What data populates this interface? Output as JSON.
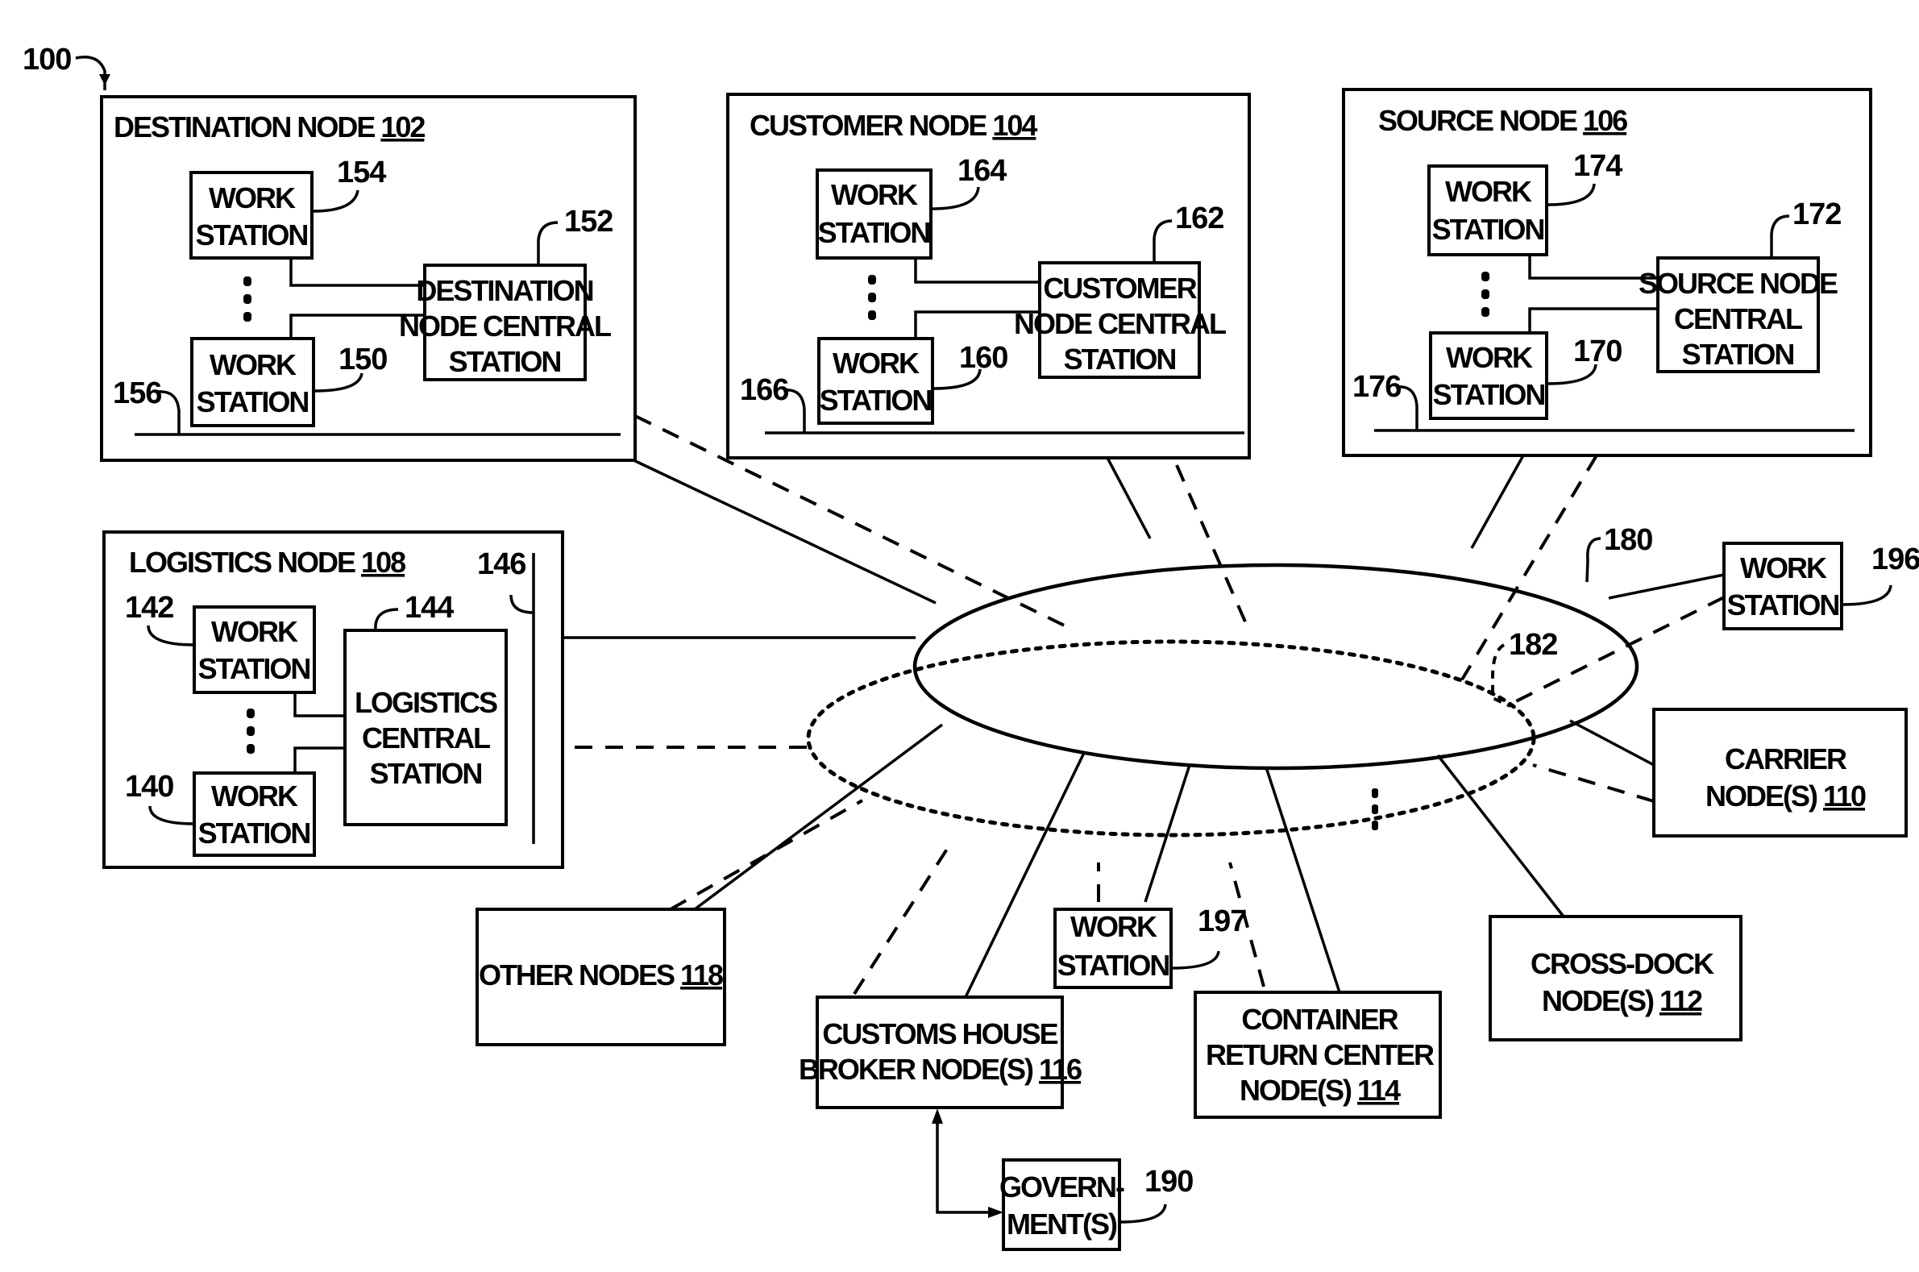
{
  "figure": {
    "ref": "100",
    "accent_color": "#000000"
  },
  "destination_node": {
    "title": "DESTINATION NODE",
    "ref": "102",
    "workstation_top": {
      "line1": "WORK",
      "line2": "STATION",
      "ref": "154"
    },
    "workstation_bottom": {
      "line1": "WORK",
      "line2": "STATION",
      "ref": "150"
    },
    "central_station": {
      "line1": "DESTINATION",
      "line2": "NODE CENTRAL",
      "line3": "STATION",
      "ref": "152"
    },
    "bus_ref": "156"
  },
  "customer_node": {
    "title": "CUSTOMER NODE",
    "ref": "104",
    "workstation_top": {
      "line1": "WORK",
      "line2": "STATION",
      "ref": "164"
    },
    "workstation_bottom": {
      "line1": "WORK",
      "line2": "STATION",
      "ref": "160"
    },
    "central_station": {
      "line1": "CUSTOMER",
      "line2": "NODE CENTRAL",
      "line3": "STATION",
      "ref": "162"
    },
    "bus_ref": "166"
  },
  "source_node": {
    "title": "SOURCE NODE",
    "ref": "106",
    "workstation_top": {
      "line1": "WORK",
      "line2": "STATION",
      "ref": "174"
    },
    "workstation_bottom": {
      "line1": "WORK",
      "line2": "STATION",
      "ref": "170"
    },
    "central_station": {
      "line1": "SOURCE NODE",
      "line2": "CENTRAL",
      "line3": "STATION",
      "ref": "172"
    },
    "bus_ref": "176"
  },
  "logistics_node": {
    "title": "LOGISTICS NODE",
    "ref": "108",
    "workstation_top": {
      "line1": "WORK",
      "line2": "STATION",
      "ref": "142"
    },
    "workstation_bottom": {
      "line1": "WORK",
      "line2": "STATION",
      "ref": "140"
    },
    "central_station": {
      "line1": "LOGISTICS",
      "line2": "CENTRAL",
      "line3": "STATION",
      "ref": "144"
    },
    "bus_ref": "146"
  },
  "networks": {
    "primary_ref": "180",
    "secondary_ref": "182"
  },
  "workstation_196": {
    "line1": "WORK",
    "line2": "STATION",
    "ref": "196"
  },
  "workstation_197": {
    "line1": "WORK",
    "line2": "STATION",
    "ref": "197"
  },
  "carrier_node": {
    "line1": "CARRIER",
    "line2": "NODE(S)",
    "ref": "110"
  },
  "cross_dock_node": {
    "line1": "CROSS-DOCK",
    "line2": "NODE(S)",
    "ref": "112"
  },
  "container_return_node": {
    "line1": "CONTAINER",
    "line2": "RETURN CENTER",
    "line3": "NODE(S)",
    "ref": "114"
  },
  "customs_broker_node": {
    "line1": "CUSTOMS HOUSE",
    "line2": "BROKER NODE(S)",
    "ref": "116"
  },
  "other_nodes": {
    "line1": "OTHER NODES",
    "ref": "118"
  },
  "government": {
    "line1": "GOVERN-",
    "line2": "MENT(S)",
    "ref": "190"
  }
}
